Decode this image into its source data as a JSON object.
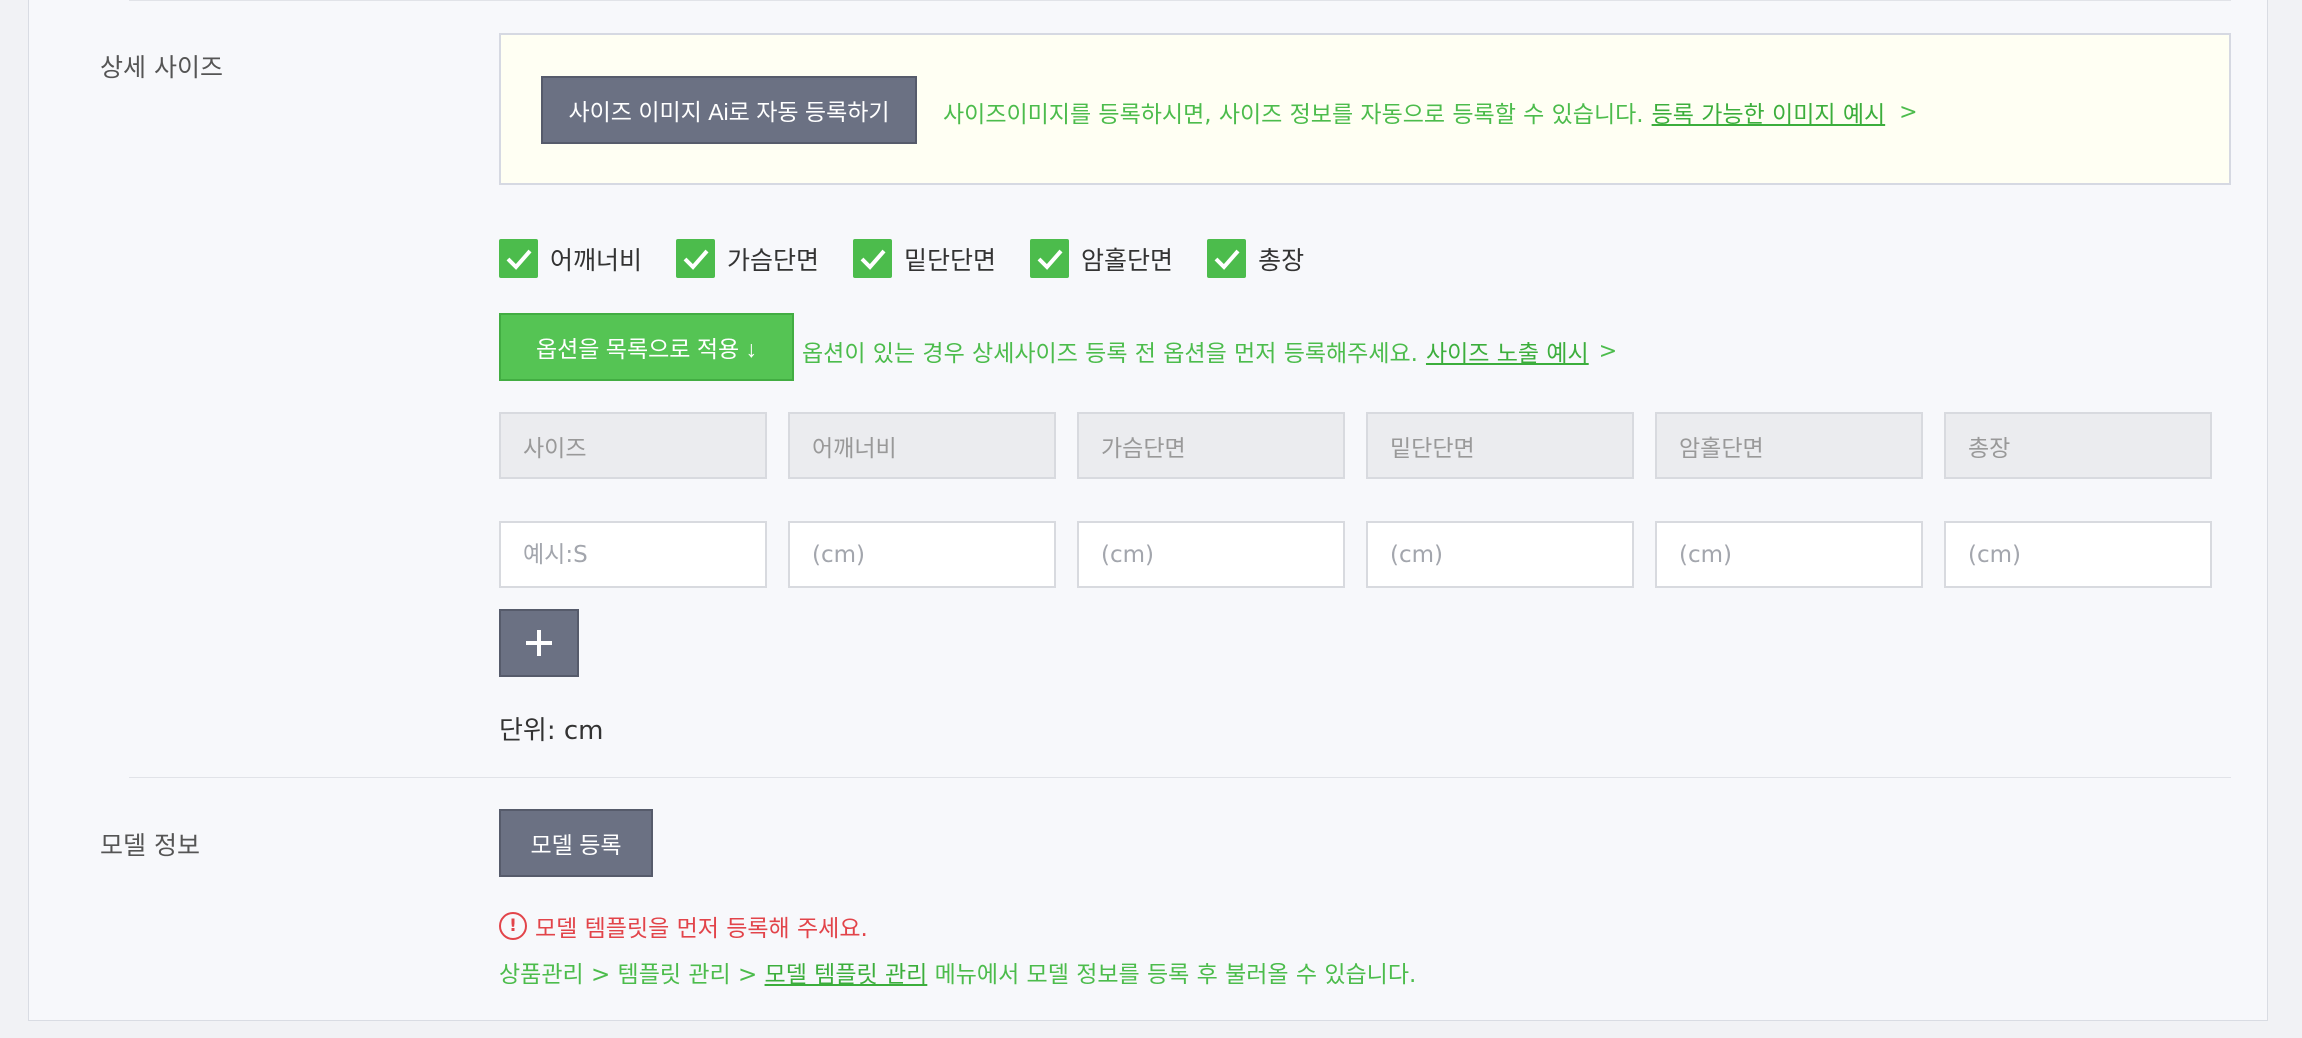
{
  "detail_size": {
    "label": "상세 사이즈",
    "ai_button": "사이즈 이미지 Ai로 자동 등록하기",
    "ai_desc": "사이즈이미지를 등록하시면, 사이즈 정보를 자동으로 등록할 수 있습니다.",
    "ai_example_link": "등록 가능한 이미지 예시",
    "checkboxes": [
      {
        "label": "어깨너비",
        "checked": true
      },
      {
        "label": "가슴단면",
        "checked": true
      },
      {
        "label": "밑단단면",
        "checked": true
      },
      {
        "label": "암홀단면",
        "checked": true
      },
      {
        "label": "총장",
        "checked": true
      }
    ],
    "apply_button": "옵션을 목록으로 적용 ↓",
    "apply_desc": "옵션이 있는 경우 상세사이즈 등록 전 옵션을 먼저 등록해주세요.",
    "apply_example_link": "사이즈 노출 예시",
    "headers": [
      "사이즈",
      "어깨너비",
      "가슴단면",
      "밑단단면",
      "암홀단면",
      "총장"
    ],
    "row_placeholders": [
      "예시:S",
      "(cm)",
      "(cm)",
      "(cm)",
      "(cm)",
      "(cm)"
    ],
    "add_row_icon": "plus-icon",
    "unit": "단위: cm"
  },
  "model_info": {
    "label": "모델 정보",
    "register_button": "모델 등록",
    "warning_icon": "exclamation-circle-icon",
    "warning_mark": "!",
    "warning": "모델 템플릿을 먼저 등록해 주세요.",
    "path_prefix": "상품관리 > 템플릿 관리 > ",
    "path_link": "모델 템플릿 관리",
    "path_suffix": " 메뉴에서 모델 정보를 등록 후 불러올 수 있습니다."
  },
  "colors": {
    "accent_green": "#4cbc4c",
    "button_dark": "#6b7183",
    "warning_red": "#e2444a",
    "ai_box_bg": "#fffff3"
  },
  "chevron_glyph": ">"
}
